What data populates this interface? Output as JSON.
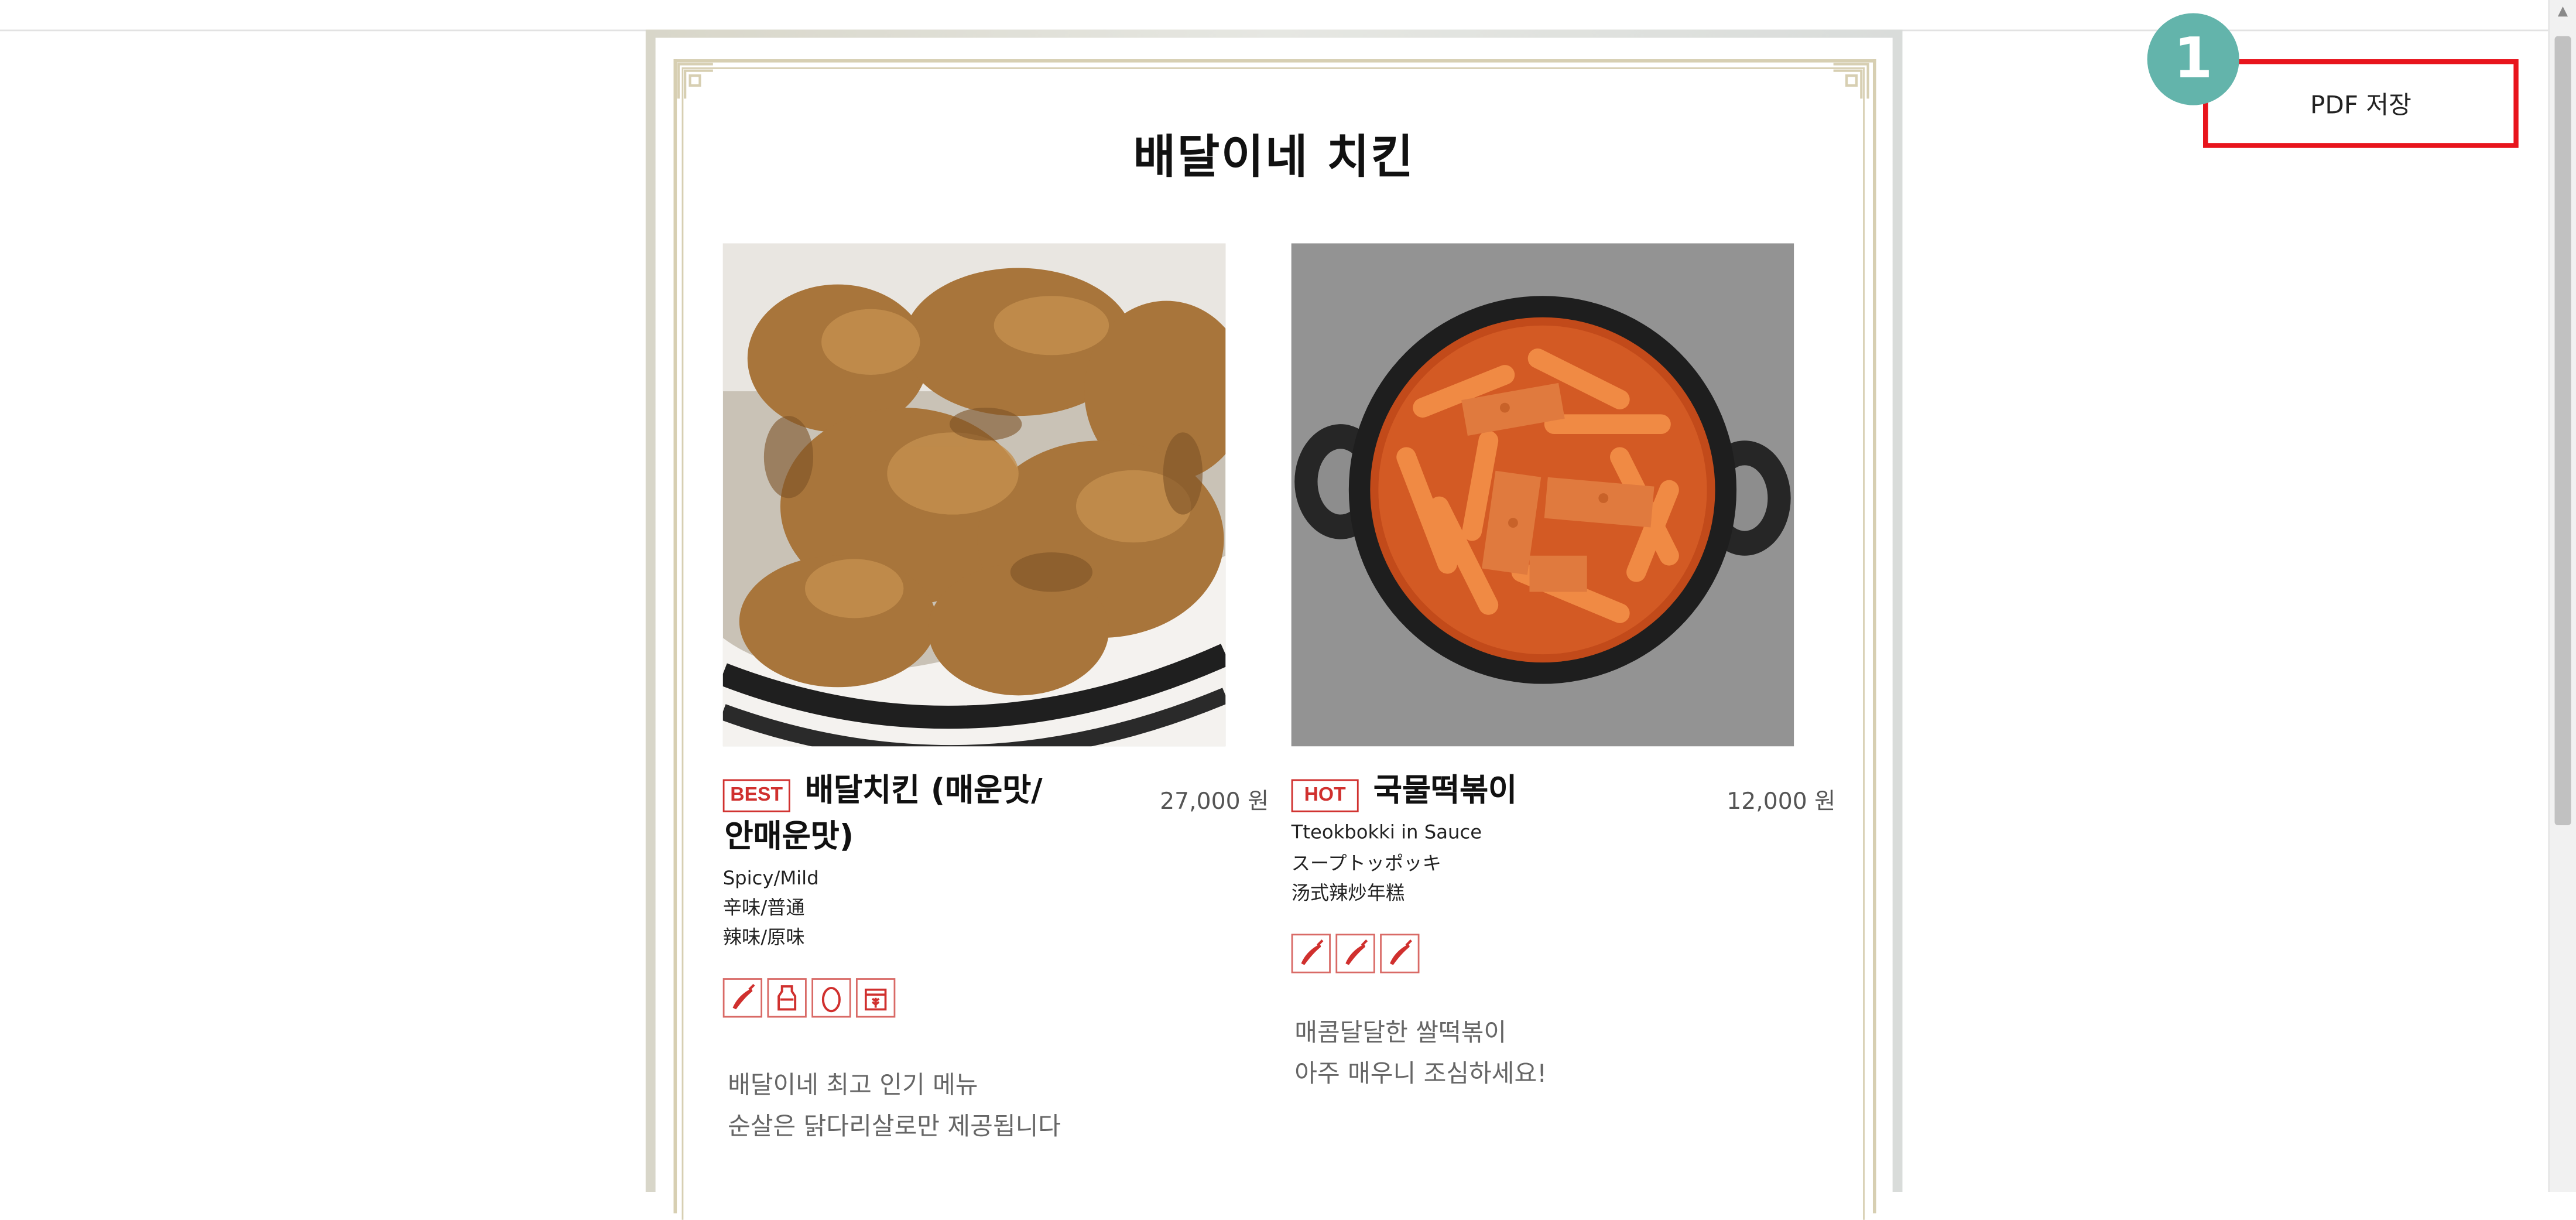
{
  "menu": {
    "title": "배달이네 치킨",
    "items": [
      {
        "badge": "BEST",
        "name_line1": "배달치킨 (매운맛/",
        "name_line2": "안매운맛)",
        "price": "27,000 원",
        "sub_lines": [
          "Spicy/Mild",
          "辛味/普通",
          "辣味/原味"
        ],
        "allergens": [
          "chili-pepper-icon",
          "milk-bottle-icon",
          "egg-icon",
          "wheat-bag-icon"
        ],
        "description_lines": [
          "배달이네 최고 인기 메뉴",
          "순살은 닭다리살로만 제공됩니다"
        ]
      },
      {
        "badge": "HOT",
        "name_line1": "국물떡볶이",
        "price": "12,000 원",
        "sub_lines": [
          "Tteokbokki in Sauce",
          "スープトッポッキ",
          "汤式辣炒年糕"
        ],
        "allergens": [
          "chili-pepper-icon",
          "chili-pepper-icon",
          "chili-pepper-icon"
        ],
        "description_lines": [
          "매콤달달한 쌀떡볶이",
          "아주 매우니 조심하세요!"
        ]
      }
    ]
  },
  "toolbar": {
    "pdf_label": "PDF 저장",
    "step_number": "1"
  },
  "colors": {
    "badge_red": "#d0302e",
    "frame_gold": "#d7cfb2",
    "highlight_red": "#e8141c",
    "step_teal": "#63b4ab"
  }
}
